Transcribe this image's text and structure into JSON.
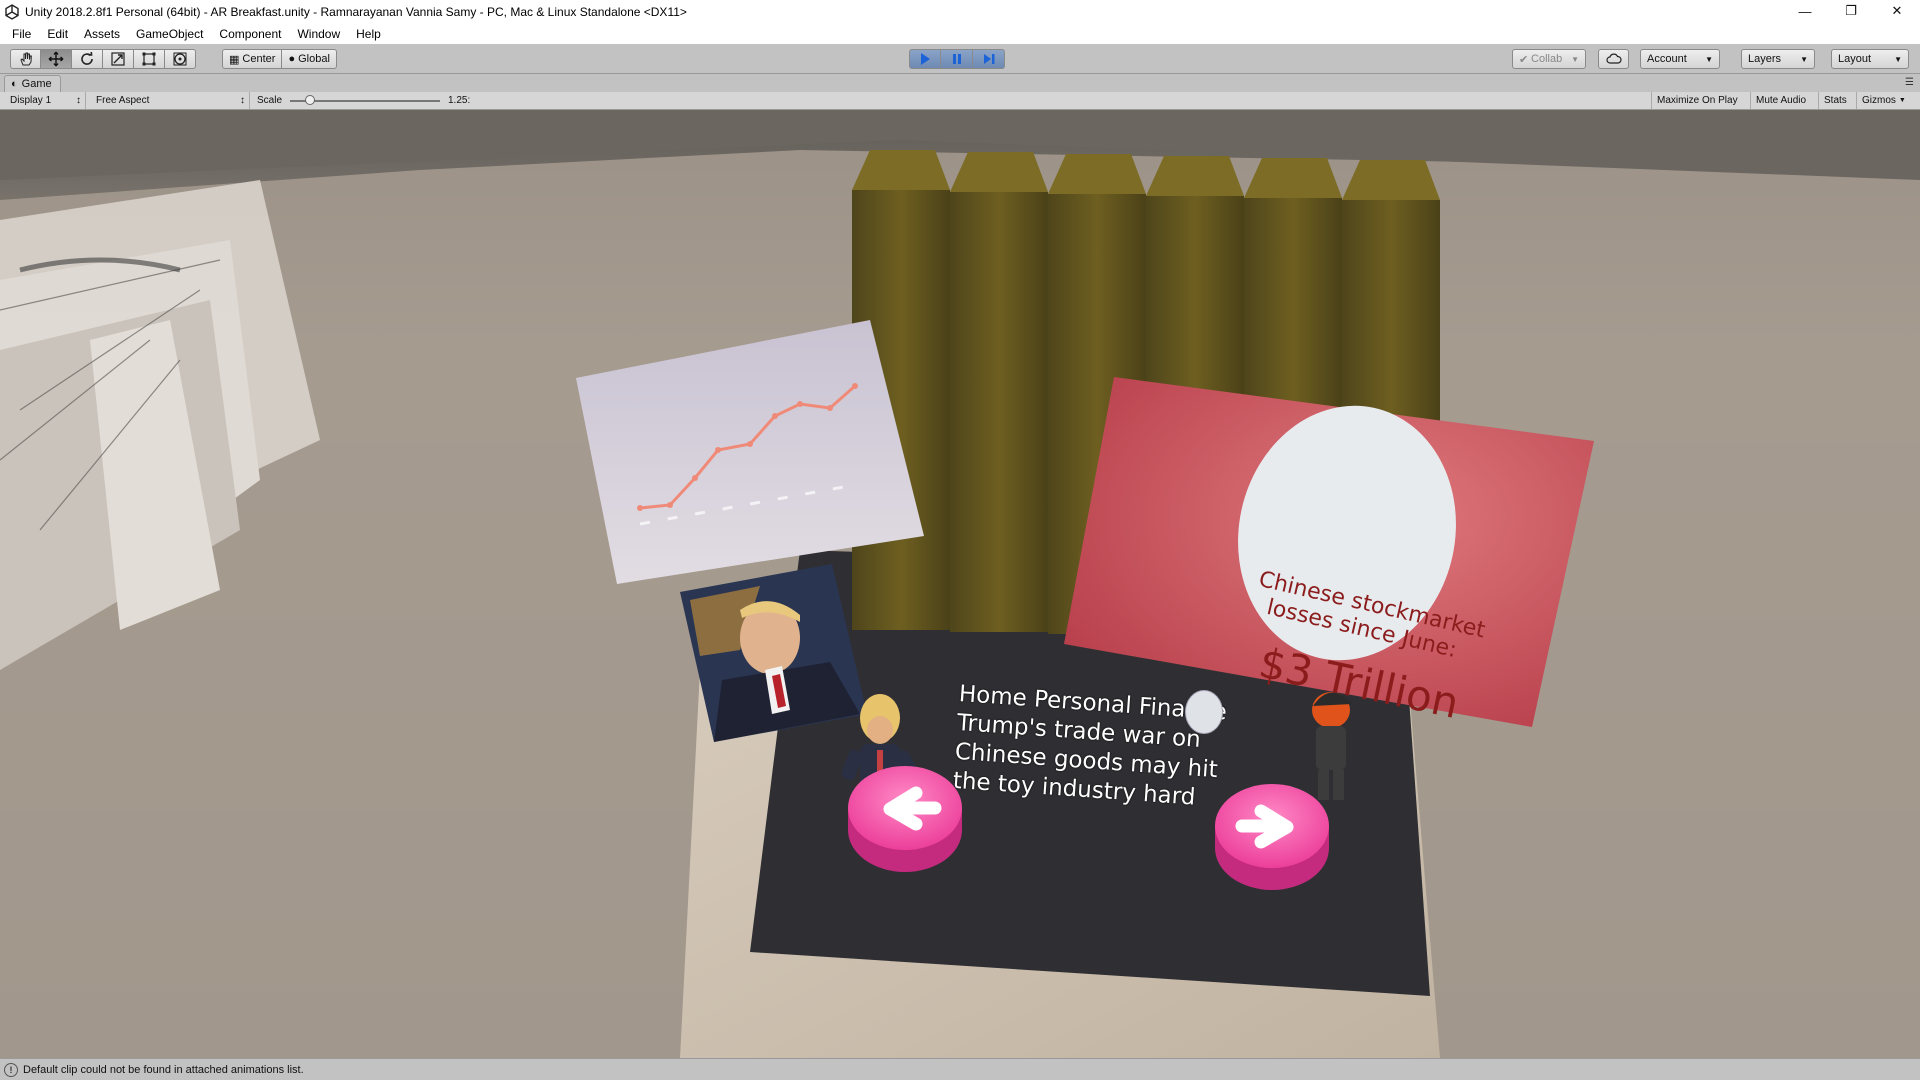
{
  "window": {
    "title": "Unity 2018.2.8f1 Personal (64bit) - AR Breakfast.unity - Ramnarayanan Vannia Samy - PC, Mac & Linux Standalone <DX11>",
    "icon": "unity-icon",
    "controls": [
      "minimize-icon",
      "restore-icon",
      "close-icon"
    ]
  },
  "menu": {
    "items": [
      "File",
      "Edit",
      "Assets",
      "GameObject",
      "Component",
      "Window",
      "Help"
    ]
  },
  "toolbar": {
    "tools": [
      "hand-icon",
      "move-icon",
      "rotate-icon",
      "scale-icon",
      "rect-icon",
      "transform-icon"
    ],
    "active_tool": "move-icon",
    "pivot": "Center",
    "space": "Global",
    "play_controls": [
      "play-icon",
      "pause-icon",
      "step-icon"
    ],
    "playing": true,
    "collab": "Collab",
    "account": "Account",
    "layers": "Layers",
    "layout": "Layout"
  },
  "game_tab": {
    "label": "Game",
    "icon": "game-icon"
  },
  "game_bar": {
    "display": "Display 1",
    "aspect": "Free Aspect",
    "scale_label": "Scale",
    "scale_value": "1.25:",
    "scale_fraction": 0.13,
    "toggles": [
      "Maximize On Play",
      "Mute Audio",
      "Stats",
      "Gizmos"
    ]
  },
  "scene": {
    "headline": [
      "Home Personal Finance",
      "Trump's trade war on",
      "Chinese goods may hit",
      "the toy industry hard"
    ],
    "card": {
      "line1": "Chinese stockmarket",
      "line2": "losses since June:",
      "amount": "$3 Trillion"
    },
    "accent_colors": {
      "button_pink": "#ec3f9a",
      "card_red": "#cf4f5c",
      "pencil_olive": "#6e5f20",
      "chart_line": "#f08a78"
    }
  },
  "status": {
    "icon": "info-icon",
    "message": "Default clip could not be found in attached animations list."
  }
}
